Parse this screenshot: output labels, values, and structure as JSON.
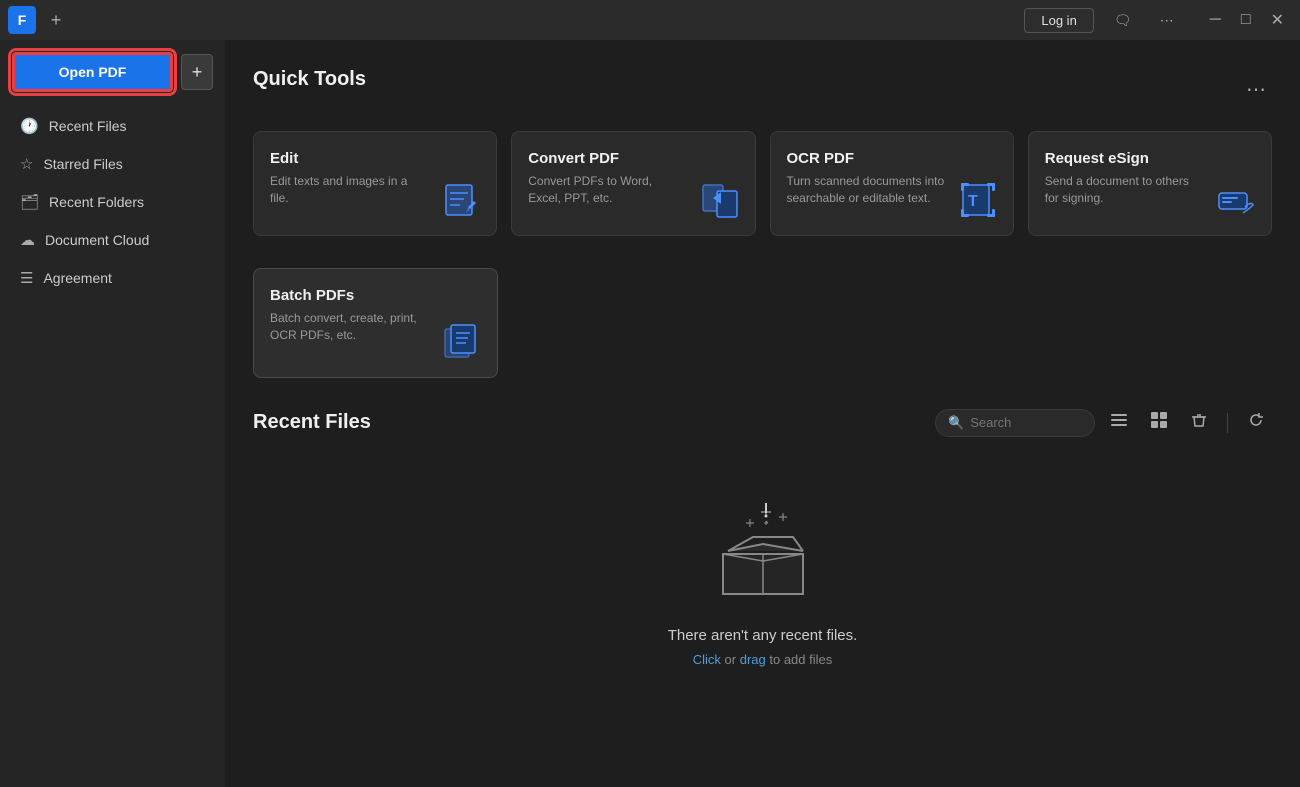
{
  "titlebar": {
    "app_icon_label": "F",
    "tab_add_label": "+",
    "login_label": "Log in",
    "more_icon": "⋯",
    "minimize_icon": "─",
    "maximize_icon": "□",
    "close_icon": "✕"
  },
  "sidebar": {
    "open_pdf_label": "Open PDF",
    "add_label": "+",
    "nav_items": [
      {
        "id": "recent-files",
        "icon": "clock",
        "label": "Recent Files"
      },
      {
        "id": "starred-files",
        "icon": "star",
        "label": "Starred Files"
      },
      {
        "id": "recent-folders",
        "icon": "folder",
        "label": "Recent Folders"
      },
      {
        "id": "document-cloud",
        "icon": "cloud",
        "label": "Document Cloud"
      },
      {
        "id": "agreement",
        "icon": "document",
        "label": "Agreement"
      }
    ]
  },
  "quick_tools": {
    "section_title": "Quick Tools",
    "more_icon": "⋯",
    "tools": [
      {
        "id": "edit",
        "title": "Edit",
        "description": "Edit texts and images in a file."
      },
      {
        "id": "convert-pdf",
        "title": "Convert PDF",
        "description": "Convert PDFs to Word, Excel, PPT, etc."
      },
      {
        "id": "ocr-pdf",
        "title": "OCR PDF",
        "description": "Turn scanned documents into searchable or editable text."
      },
      {
        "id": "request-esign",
        "title": "Request eSign",
        "description": "Send a document to others for signing."
      }
    ],
    "batch_tool": {
      "id": "batch-pdfs",
      "title": "Batch PDFs",
      "description": "Batch convert, create, print, OCR PDFs, etc."
    }
  },
  "recent_files": {
    "section_title": "Recent Files",
    "search_placeholder": "Search",
    "empty_title": "There aren't any recent files.",
    "empty_sub_text": " or ",
    "empty_click": "Click",
    "empty_drag": "drag",
    "empty_suffix": " to add files"
  },
  "colors": {
    "accent_blue": "#1a73e8",
    "accent_red": "#e84040",
    "link_blue": "#4d9de0"
  }
}
